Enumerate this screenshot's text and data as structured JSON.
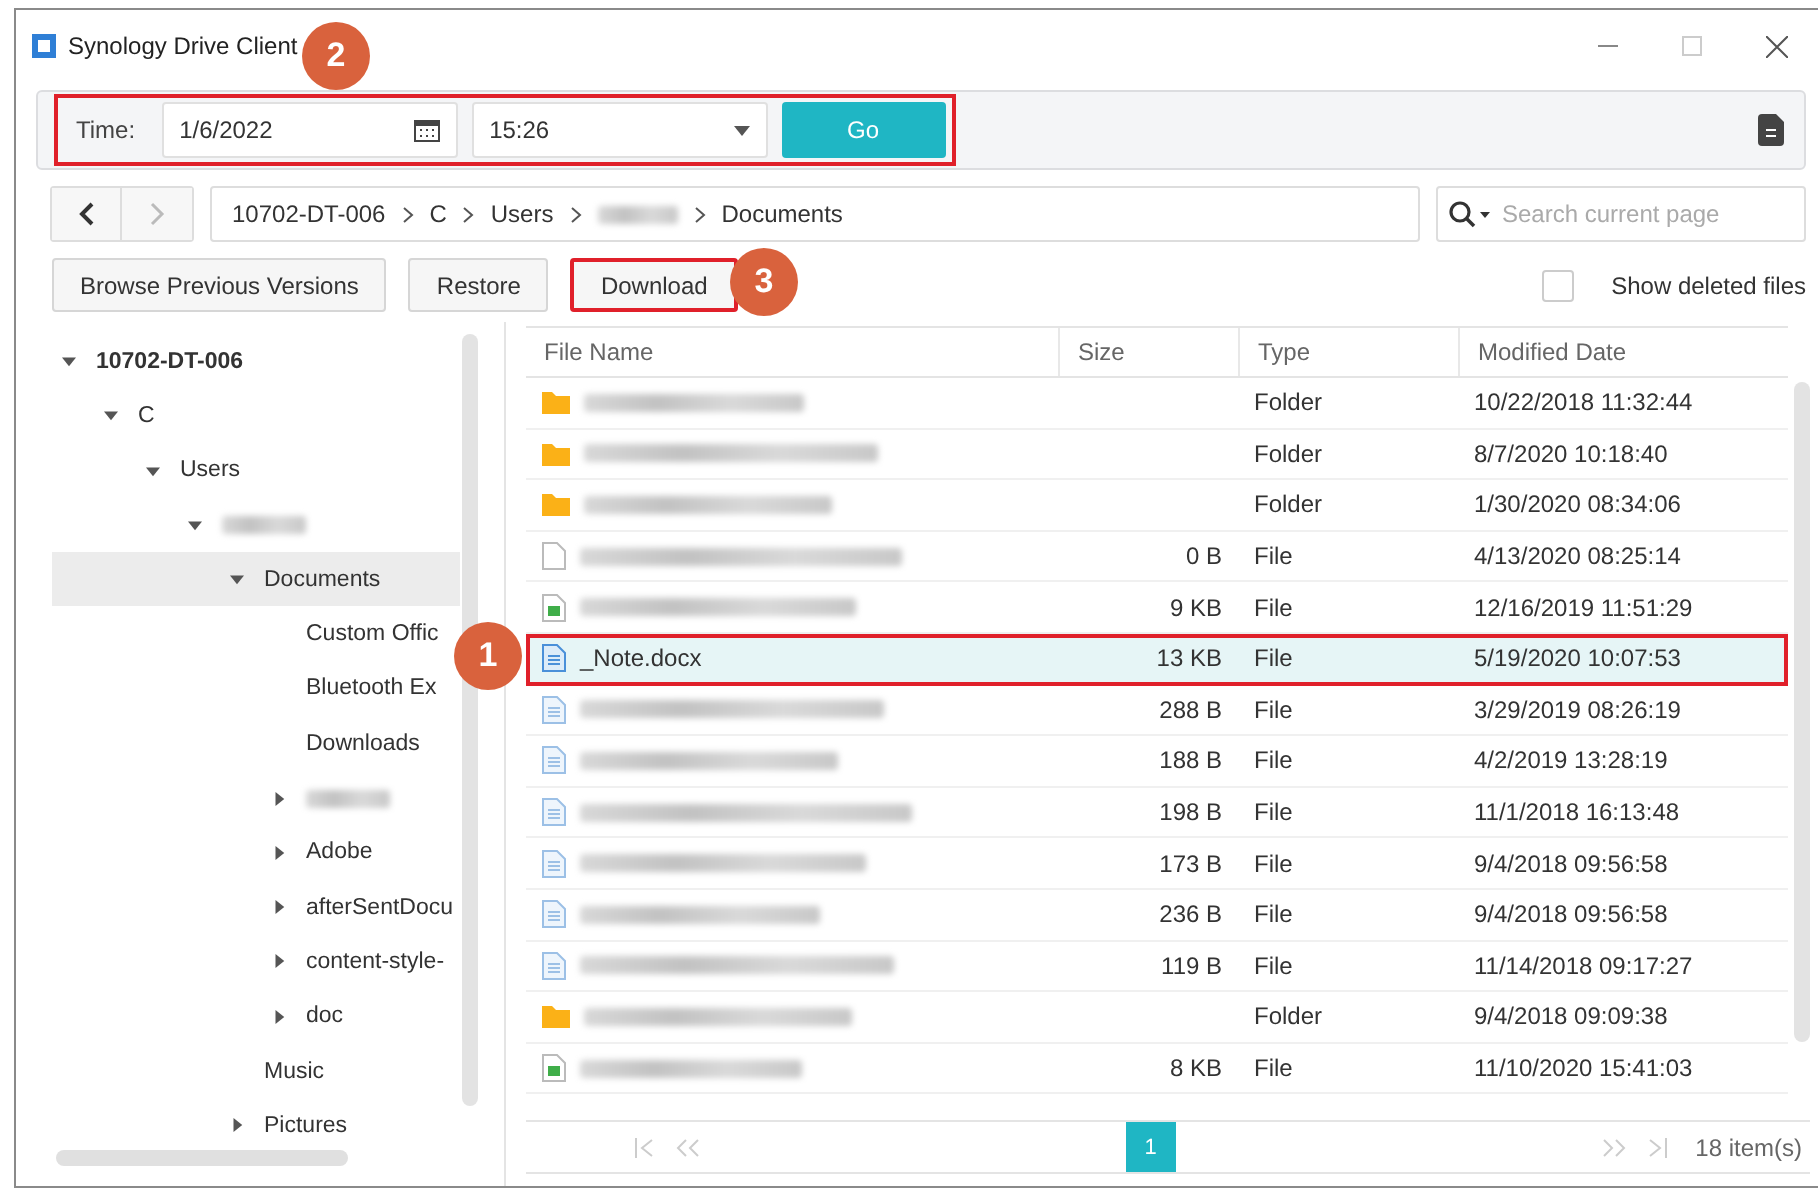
{
  "window": {
    "title": "Synology Drive Client"
  },
  "time_bar": {
    "highlighted": true,
    "label": "Time:",
    "date": "1/6/2022",
    "time": "15:26",
    "go": "Go"
  },
  "breadcrumb": [
    {
      "label": "10702-DT-006",
      "blurred": false
    },
    {
      "label": "C",
      "blurred": false
    },
    {
      "label": "Users",
      "blurred": false
    },
    {
      "blurred": true
    },
    {
      "label": "Documents",
      "blurred": false
    }
  ],
  "search": {
    "placeholder": "Search current page"
  },
  "actions": [
    {
      "label": "Browse Previous Versions",
      "highlighted": false
    },
    {
      "label": "Restore",
      "highlighted": false
    },
    {
      "label": "Download",
      "highlighted": true
    }
  ],
  "show_deleted": {
    "label": "Show deleted files",
    "checked": false
  },
  "tree": [
    {
      "label": "10702-DT-006",
      "expandable": true,
      "expanded": true,
      "selected": false,
      "children": [
        {
          "label": "C",
          "expandable": true,
          "expanded": true,
          "selected": false,
          "children": [
            {
              "label": "Users",
              "expandable": true,
              "expanded": true,
              "selected": false,
              "children": [
                {
                  "blurred": true,
                  "expandable": true,
                  "expanded": true,
                  "selected": false,
                  "children": [
                    {
                      "label": "Documents",
                      "expandable": true,
                      "expanded": true,
                      "selected": true,
                      "children": [
                        {
                          "label": "Custom Offic",
                          "expandable": false,
                          "selected": false
                        },
                        {
                          "label": "Bluetooth Ex",
                          "expandable": false,
                          "selected": false
                        },
                        {
                          "label": "Downloads",
                          "expandable": false,
                          "selected": false
                        },
                        {
                          "blurred": true,
                          "expandable": true,
                          "expanded": false,
                          "selected": false
                        },
                        {
                          "label": "Adobe",
                          "expandable": true,
                          "expanded": false,
                          "selected": false
                        },
                        {
                          "label": "afterSentDocu",
                          "expandable": true,
                          "expanded": false,
                          "selected": false
                        },
                        {
                          "label": "content-style-",
                          "expandable": true,
                          "expanded": false,
                          "selected": false
                        },
                        {
                          "label": "doc",
                          "expandable": true,
                          "expanded": false,
                          "selected": false
                        }
                      ]
                    },
                    {
                      "label": "Music",
                      "expandable": false,
                      "selected": false
                    },
                    {
                      "label": "Pictures",
                      "expandable": true,
                      "expanded": false,
                      "selected": false
                    }
                  ]
                }
              ]
            }
          ]
        }
      ]
    }
  ],
  "table": {
    "columns": [
      "File Name",
      "Size",
      "Type",
      "Modified Date"
    ],
    "rows": [
      {
        "kind": "folder",
        "blurred": true,
        "size": "",
        "type": "Folder",
        "modified": "10/22/2018 11:32:44",
        "selected": false,
        "highlighted": false
      },
      {
        "kind": "folder",
        "blurred": true,
        "size": "",
        "type": "Folder",
        "modified": "8/7/2020 10:18:40",
        "selected": false,
        "highlighted": false
      },
      {
        "kind": "folder",
        "blurred": true,
        "size": "",
        "type": "Folder",
        "modified": "1/30/2020 08:34:06",
        "selected": false,
        "highlighted": false
      },
      {
        "kind": "blank",
        "blurred": true,
        "size": "0 B",
        "type": "File",
        "modified": "4/13/2020 08:25:14",
        "selected": false,
        "highlighted": false
      },
      {
        "kind": "sheet",
        "blurred": true,
        "size": "9 KB",
        "type": "File",
        "modified": "12/16/2019 11:51:29",
        "selected": false,
        "highlighted": false
      },
      {
        "kind": "doc",
        "name": "_Note.docx",
        "blurred": false,
        "size": "13 KB",
        "type": "File",
        "modified": "5/19/2020 10:07:53",
        "selected": true,
        "highlighted": true
      },
      {
        "kind": "text",
        "blurred": true,
        "size": "288 B",
        "type": "File",
        "modified": "3/29/2019 08:26:19",
        "selected": false,
        "highlighted": false
      },
      {
        "kind": "text",
        "blurred": true,
        "size": "188 B",
        "type": "File",
        "modified": "4/2/2019 13:28:19",
        "selected": false,
        "highlighted": false
      },
      {
        "kind": "text",
        "blurred": true,
        "size": "198 B",
        "type": "File",
        "modified": "11/1/2018 16:13:48",
        "selected": false,
        "highlighted": false
      },
      {
        "kind": "text",
        "blurred": true,
        "size": "173 B",
        "type": "File",
        "modified": "9/4/2018 09:56:58",
        "selected": false,
        "highlighted": false
      },
      {
        "kind": "text",
        "blurred": true,
        "size": "236 B",
        "type": "File",
        "modified": "9/4/2018 09:56:58",
        "selected": false,
        "highlighted": false
      },
      {
        "kind": "text",
        "blurred": true,
        "size": "119 B",
        "type": "File",
        "modified": "11/14/2018 09:17:27",
        "selected": false,
        "highlighted": false
      },
      {
        "kind": "folder",
        "blurred": true,
        "size": "",
        "type": "Folder",
        "modified": "9/4/2018 09:09:38",
        "selected": false,
        "highlighted": false
      },
      {
        "kind": "sheet",
        "blurred": true,
        "size": "8 KB",
        "type": "File",
        "modified": "11/10/2020 15:41:03",
        "selected": false,
        "highlighted": false
      }
    ]
  },
  "pagination": {
    "pages": [
      {
        "label": "1",
        "selected": true
      }
    ],
    "count": "18 item(s)"
  },
  "callouts": [
    {
      "label": "2"
    },
    {
      "label": "3"
    },
    {
      "label": "1"
    }
  ]
}
